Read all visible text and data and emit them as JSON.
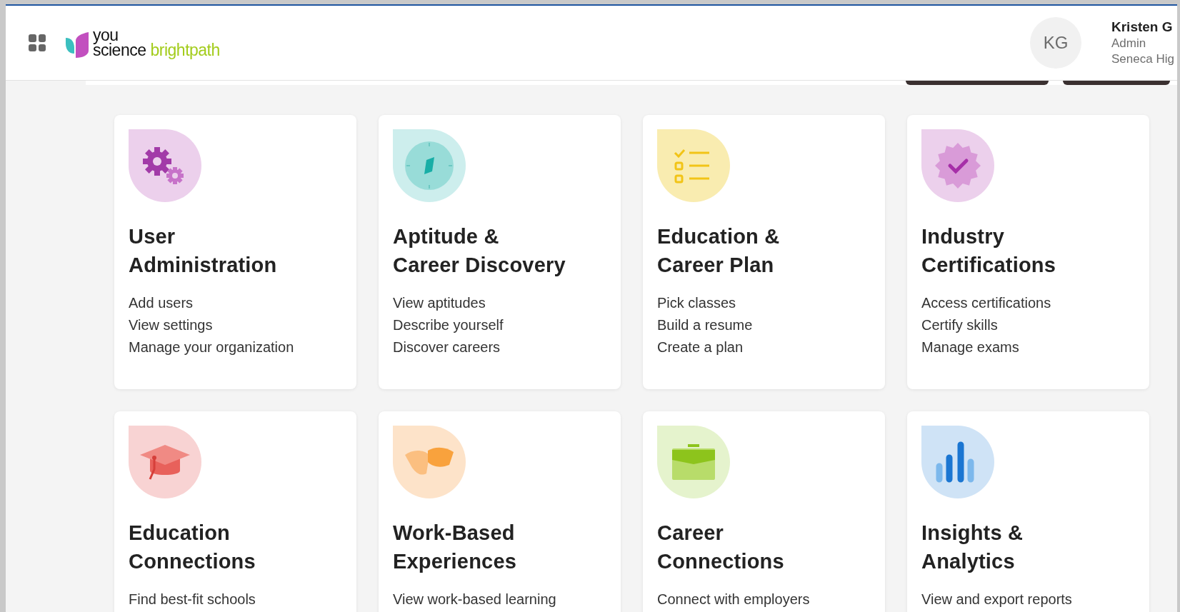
{
  "header": {
    "logo": {
      "word_1": "you",
      "word_2": "science",
      "product": "brightpath"
    },
    "user": {
      "initials": "KG",
      "name": "Kristen G",
      "role": "Admin",
      "school": "Seneca Hig"
    }
  },
  "cards": [
    {
      "title_lines": [
        "User",
        "Administration"
      ],
      "items": [
        "Add users",
        "View settings",
        "Manage your organization"
      ]
    },
    {
      "title_lines": [
        "Aptitude &",
        "Career Discovery"
      ],
      "items": [
        "View aptitudes",
        "Describe yourself",
        "Discover careers"
      ]
    },
    {
      "title_lines": [
        "Education &",
        "Career Plan"
      ],
      "items": [
        "Pick classes",
        "Build a resume",
        "Create a plan"
      ]
    },
    {
      "title_lines": [
        "Industry",
        "Certifications"
      ],
      "items": [
        "Access certifications",
        "Certify skills",
        "Manage exams"
      ]
    },
    {
      "title_lines": [
        "Education",
        "Connections"
      ],
      "items": [
        "Find best-fit schools"
      ]
    },
    {
      "title_lines": [
        "Work-Based",
        "Experiences"
      ],
      "items": [
        "View work-based learning"
      ]
    },
    {
      "title_lines": [
        "Career",
        "Connections"
      ],
      "items": [
        "Connect with employers"
      ]
    },
    {
      "title_lines": [
        "Insights &",
        "Analytics"
      ],
      "items": [
        "View and export reports"
      ]
    }
  ]
}
